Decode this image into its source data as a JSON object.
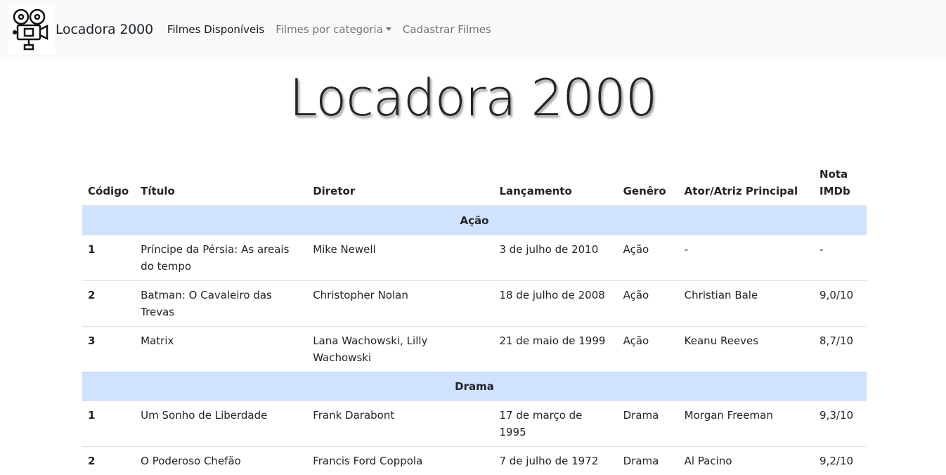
{
  "navbar": {
    "brand": "Locadora 2000",
    "links": [
      {
        "label": "Filmes Disponíveis"
      },
      {
        "label": "Filmes por categoria"
      },
      {
        "label": "Cadastrar Filmes"
      }
    ]
  },
  "hero": {
    "title": "Locadora 2000"
  },
  "table": {
    "headers": [
      "Código",
      "Título",
      "Diretor",
      "Lançamento",
      "Genêro",
      "Ator/Atriz Principal",
      "Nota IMDb"
    ],
    "groups": [
      {
        "name": "Ação",
        "rows": [
          [
            "1",
            "Príncipe da Pérsia: As areais do tempo",
            "Mike Newell",
            "3 de julho de 2010",
            "Ação",
            "-",
            "-"
          ],
          [
            "2",
            "Batman: O Cavaleiro das Trevas",
            "Christopher Nolan",
            "18 de julho de 2008",
            "Ação",
            "Christian Bale",
            "9,0/10"
          ],
          [
            "3",
            "Matrix",
            "Lana Wachowski, Lilly Wachowski",
            "21 de maio de 1999",
            "Ação",
            "Keanu Reeves",
            "8,7/10"
          ]
        ]
      },
      {
        "name": "Drama",
        "rows": [
          [
            "1",
            "Um Sonho de Liberdade",
            "Frank Darabont",
            "17 de março de 1995",
            "Drama",
            "Morgan Freeman",
            "9,3/10"
          ],
          [
            "2",
            "O Poderoso Chefão",
            "Francis Ford Coppola",
            "7 de julho de 1972",
            "Drama",
            "Al Pacino",
            "9,2/10"
          ]
        ]
      }
    ]
  }
}
